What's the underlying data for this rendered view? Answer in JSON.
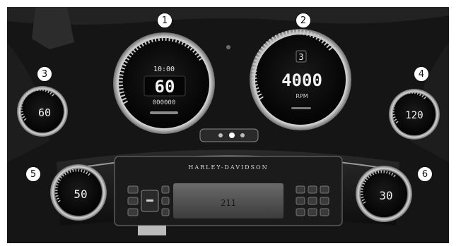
{
  "callouts": [
    "1",
    "2",
    "3",
    "4",
    "5",
    "6"
  ],
  "speedometer": {
    "time": "10:00",
    "speed": "60",
    "odometer": "000000"
  },
  "tachometer": {
    "gear": "3",
    "rpm": "4000",
    "unit": "RPM"
  },
  "gauge_left_upper": {
    "value": "60"
  },
  "gauge_right_upper": {
    "value": "120"
  },
  "gauge_left_lower": {
    "value": "50"
  },
  "gauge_right_lower": {
    "value": "30"
  },
  "radio": {
    "brand": "HARLEY-DAVIDSON",
    "display": "211"
  },
  "colors": {
    "panel": "#141414",
    "bezel": "#c8c8c8",
    "face": "#050505",
    "display": "#e6e6e6",
    "trim": "#8a8a8a"
  }
}
